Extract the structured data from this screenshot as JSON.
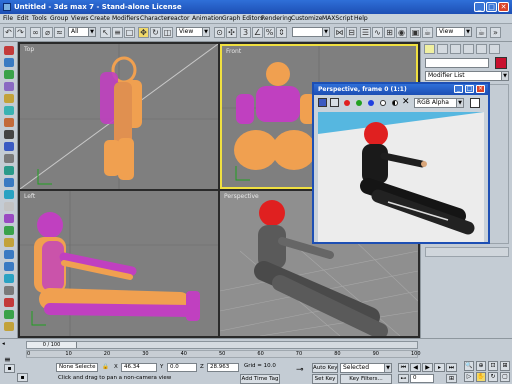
{
  "window": {
    "title": "Untitled - 3ds max 7  - Stand-alone License",
    "minimize": "_",
    "maximize": "□",
    "close": "✕"
  },
  "menu": [
    "File",
    "Edit",
    "Tools",
    "Group",
    "Views",
    "Create",
    "Modifiers",
    "Character",
    "reactor",
    "Animation",
    "Graph Editors",
    "Rendering",
    "Customize",
    "MAXScript",
    "Help"
  ],
  "toolbar": {
    "ref_coord": "View",
    "all_filter": "All",
    "view_right": "View"
  },
  "viewports": {
    "top": "Top",
    "front": "Front",
    "left": "Left",
    "perspective": "Perspective"
  },
  "command_panel": {
    "modifier_list": "Modifier List"
  },
  "render_window": {
    "title": "Perspective, frame 0 (1:1)",
    "channel": "RGB Alpha"
  },
  "timeline": {
    "frame": "0 / 100",
    "ticks": [
      "0",
      "10",
      "20",
      "30",
      "40",
      "50",
      "60",
      "70",
      "80",
      "90",
      "100"
    ]
  },
  "status": {
    "selection": "None Selecte",
    "x_label": "X",
    "x_value": "46.34",
    "y_label": "Y",
    "y_value": "0.0",
    "z_label": "Z",
    "z_value": "28.963",
    "grid": "Grid = 10.0",
    "add_time_tag": "Add Time Tag",
    "prompt": "Click and drag to pan a non-camera view",
    "auto_key": "Auto Key",
    "selected": "Selected",
    "set_key": "Set Key",
    "key_filters": "Key Filters...",
    "current_frame": "0"
  },
  "colors": {
    "title_blue": "#1d4fb4",
    "active_border": "#f0e040",
    "wire_orange": "#f0a050",
    "wire_magenta": "#c040c0",
    "helmet_red": "#e02020"
  }
}
